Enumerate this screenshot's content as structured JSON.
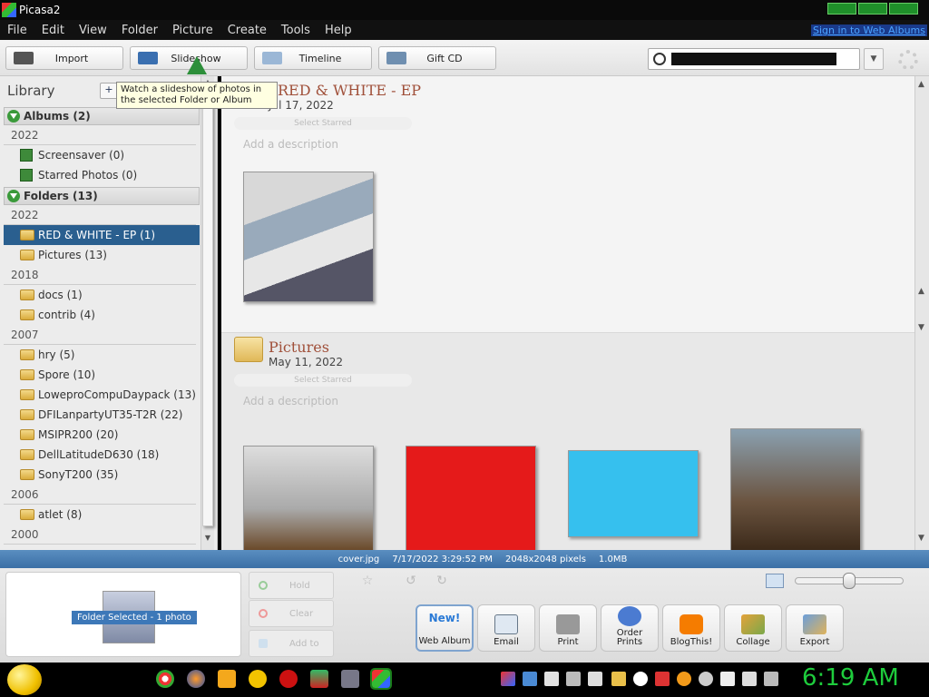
{
  "window": {
    "title": "Picasa2"
  },
  "menu": [
    "File",
    "Edit",
    "View",
    "Folder",
    "Picture",
    "Create",
    "Tools",
    "Help"
  ],
  "menu_signin": "Sign in to Web Albums",
  "toolbar": {
    "import": "Import",
    "slideshow": "Slideshow",
    "timeline": "Timeline",
    "giftcd": "Gift CD"
  },
  "tooltip": "Watch a slideshow of photos in the selected Folder or Album",
  "library": {
    "title": "Library",
    "add_label": "+",
    "albums_header": "Albums (2)",
    "albums_year": "2022",
    "albums": [
      "Screensaver (0)",
      "Starred Photos (0)"
    ],
    "folders_header": "Folders (13)",
    "groups": [
      {
        "year": "2022",
        "items": [
          "RED & WHITE - EP (1)",
          "Pictures (13)"
        ]
      },
      {
        "year": "2018",
        "items": [
          "docs (1)",
          "contrib (4)"
        ]
      },
      {
        "year": "2007",
        "items": [
          "hry (5)",
          "Spore (10)",
          "LoweproCompuDaypack (13)",
          "DFILanpartyUT35-T2R (22)",
          "MSIPR200 (20)",
          "DellLatitudeD630 (18)",
          "SonyT200 (35)"
        ]
      },
      {
        "year": "2006",
        "items": [
          "atlet (8)"
        ]
      },
      {
        "year": "2000",
        "items": []
      }
    ]
  },
  "main": {
    "folder1": {
      "title": "RED & WHITE - EP",
      "date": "Jul 17, 2022",
      "starred": "Select Starred",
      "desc": "Add a description"
    },
    "folder2": {
      "title": "Pictures",
      "date": "May 11, 2022",
      "starred": "Select Starred",
      "desc": "Add a description"
    }
  },
  "status": {
    "file": "cover.jpg",
    "datetime": "7/17/2022 3:29:52 PM",
    "dims": "2048x2048 pixels",
    "size": "1.0MB"
  },
  "tray": {
    "selected_label": "Folder Selected - 1 photo",
    "hold": "Hold",
    "clear": "Clear",
    "addto": "Add to",
    "new_badge": "New!"
  },
  "actions": [
    "Web Album",
    "Email",
    "Print",
    "Order Prints",
    "BlogThis!",
    "Collage",
    "Export"
  ],
  "clock": "6:19 AM",
  "colors": {
    "selection": "#2a5f8f",
    "status_bar": "#3b6fa6",
    "clock": "#1ecc3c",
    "folder_title": "#a0503a"
  }
}
